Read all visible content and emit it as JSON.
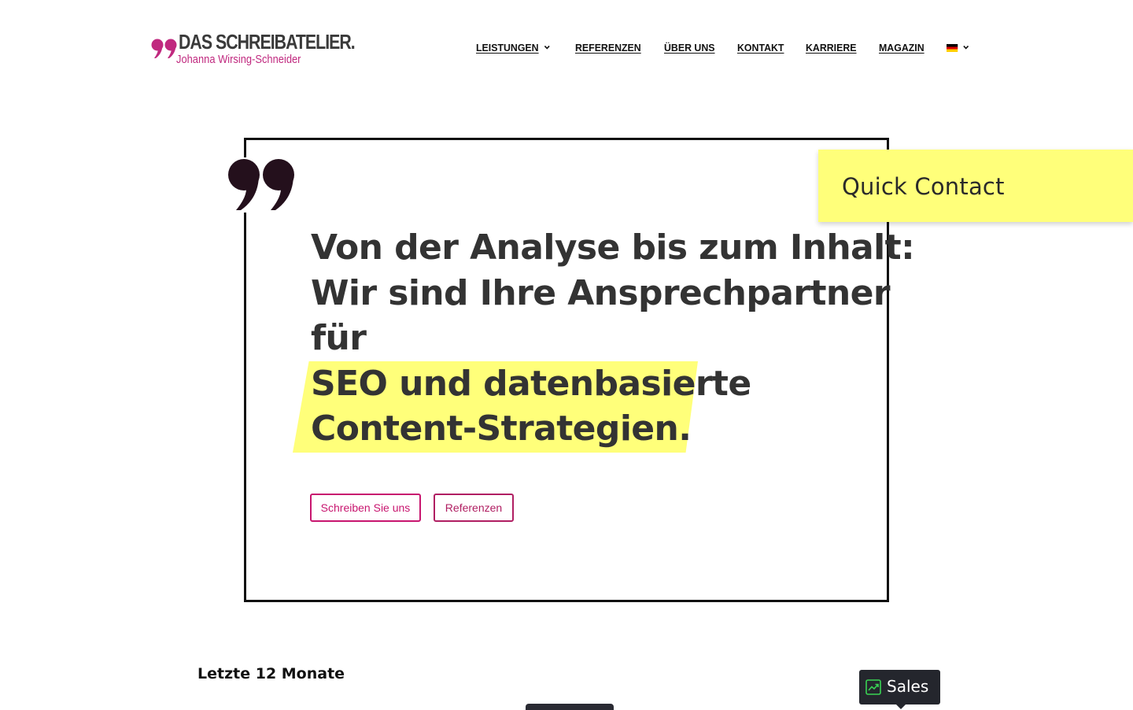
{
  "brand": {
    "title": "DAS SCHREIBATELIER.",
    "subtitle": "Johanna Wirsing-Schneider",
    "accent_color": "#c0297f",
    "quote_icon": "double-quote-icon"
  },
  "nav": {
    "items": [
      {
        "label": "LEISTUNGEN",
        "has_dropdown": true
      },
      {
        "label": "REFERENZEN",
        "has_dropdown": false
      },
      {
        "label": "ÜBER UNS",
        "has_dropdown": false
      },
      {
        "label": "KONTAKT",
        "has_dropdown": false
      },
      {
        "label": "KARRIERE",
        "has_dropdown": false
      },
      {
        "label": "MAGAZIN",
        "has_dropdown": false
      }
    ],
    "language": {
      "flag": "german-flag-icon",
      "has_dropdown": true
    }
  },
  "hero": {
    "lines": [
      "Von der Analyse bis zum Inhalt:",
      "Wir sind Ihre Ansprechpartner",
      "für"
    ],
    "highlight_lines": [
      "SEO und datenbasierte",
      "Content-Strategien."
    ],
    "highlight_color": "#ffff7a",
    "buttons": {
      "primary": "Schreiben Sie uns",
      "secondary": "Referenzen"
    }
  },
  "quick_contact": {
    "label": "Quick Contact",
    "background": "#ffff7a"
  },
  "stats": {
    "period_label": "Letzte 12 Monate"
  },
  "sales_badge": {
    "label": "Sales",
    "icon": "trending-up-icon"
  }
}
